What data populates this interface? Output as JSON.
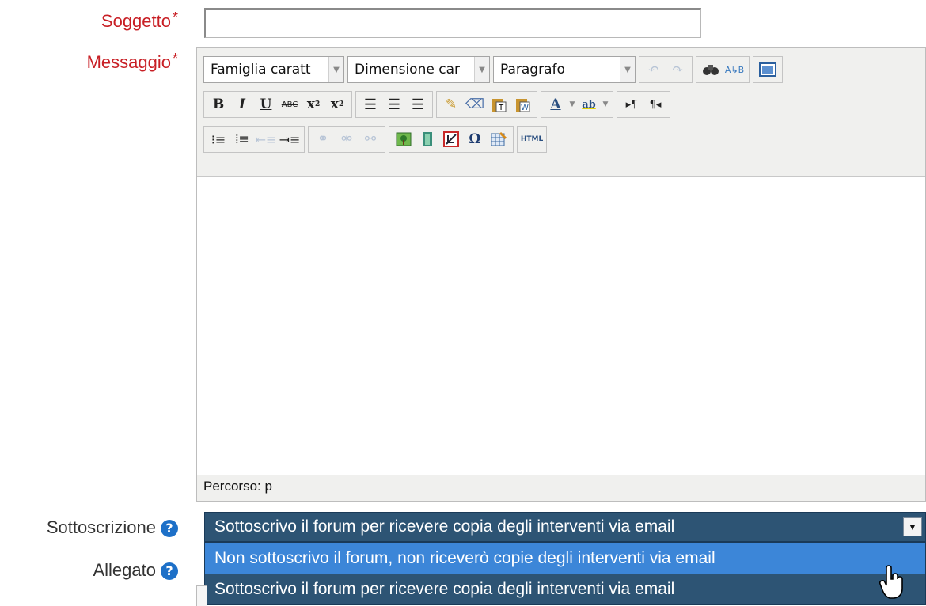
{
  "form": {
    "subject_label": "Soggetto",
    "message_label": "Messaggio",
    "required_mark": "*",
    "subject_value": "",
    "subscription_label": "Sottoscrizione",
    "attachment_label": "Allegato",
    "help_glyph": "?"
  },
  "editor": {
    "font_family_combo": "Famiglia caratt",
    "font_size_combo": "Dimensione car",
    "format_combo": "Paragrafo",
    "path_text": "Percorso: p",
    "row1_buttons": [
      "undo-icon",
      "redo-icon",
      "find-icon",
      "replace-icon",
      "fullscreen-icon"
    ],
    "row2_buttons": [
      "bold-icon",
      "italic-icon",
      "underline-icon",
      "strikethrough-icon",
      "subscript-icon",
      "superscript-icon",
      "align-left-icon",
      "align-center-icon",
      "align-right-icon",
      "cleanup-icon",
      "remove-format-icon",
      "paste-text-icon",
      "paste-word-icon",
      "font-color-icon",
      "highlight-color-icon",
      "ltr-icon",
      "rtl-icon"
    ],
    "row3_buttons": [
      "bullet-list-icon",
      "numbered-list-icon",
      "outdent-icon",
      "indent-icon",
      "link-icon",
      "unlink-icon",
      "anchor-icon",
      "image-icon",
      "media-icon",
      "nolink-icon",
      "special-char-icon",
      "table-icon",
      "html-source-icon"
    ],
    "html_label": "HTML"
  },
  "subscription": {
    "selected": "Sottoscrivo il forum per ricevere copia degli interventi via email",
    "options": [
      "Non sottoscrivo il forum, non riceverò copie degli interventi via email",
      "Sottoscrivo il forum per ricevere copia degli interventi via email"
    ],
    "highlighted_index": 0
  },
  "colors": {
    "required": "#c81f25",
    "select_bg": "#2d5474",
    "option_highlight": "#3c86d8",
    "help_icon": "#1d70c8"
  }
}
